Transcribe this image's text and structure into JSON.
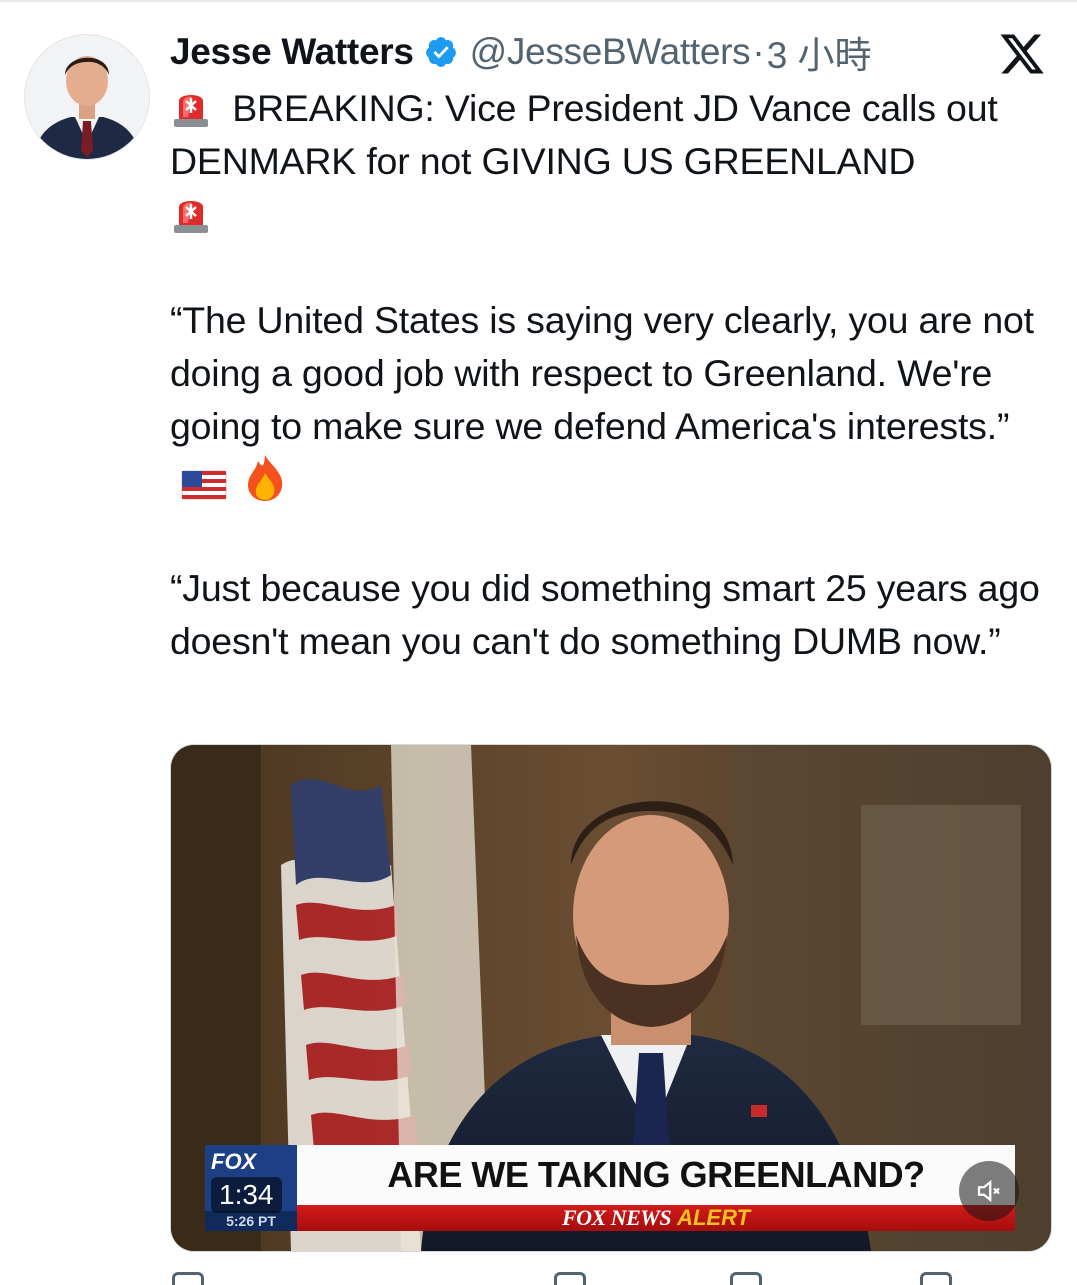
{
  "author": {
    "name": "Jesse Watters",
    "handle": "@JesseBWatters",
    "separator": "·",
    "time": "3 小時",
    "verified": true
  },
  "icons": {
    "verified": "verified-badge-icon",
    "platform": "x-logo-icon",
    "siren": "police-light-emoji",
    "flag": "us-flag-emoji",
    "fire": "fire-emoji",
    "mute": "volume-muted-icon"
  },
  "tweet": {
    "line1": "BREAKING: Vice President JD Vance calls out DENMARK for not GIVING US GREENLAND",
    "quote1": "“The United States is saying very clearly, you are not doing a good job with respect to Greenland. We're going to make sure we defend America's interests.”",
    "quote2": "“Just because you did something smart 25 years ago doesn't mean you can't do something DUMB now.”"
  },
  "video": {
    "headline": "ARE WE TAKING GREENLAND?",
    "network": "FOX NEWS",
    "alert": "ALERT",
    "logo": "FOX",
    "clock": "5:26 PT",
    "duration": "1:34"
  },
  "colors": {
    "text": "#0f1419",
    "secondary": "#536471",
    "verified": "#1d9bf0",
    "chyron_red": "#c4151a",
    "fox_blue": "#1c3f86",
    "alert_yellow": "#f6c21b"
  }
}
